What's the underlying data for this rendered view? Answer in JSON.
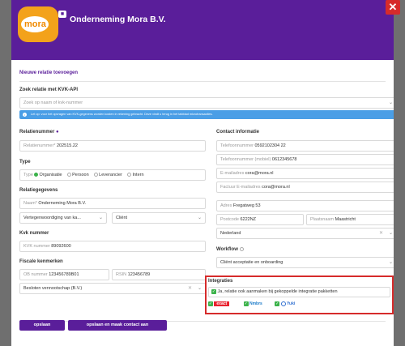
{
  "header": {
    "company_name": "Onderneming Mora B.V.",
    "logo_text": "mora"
  },
  "section_title": "Nieuwe relatie toevoegen",
  "kvk_api": {
    "label": "Zoek relatie met KVK-API",
    "placeholder": "Zoek op naam of kvk-nummer",
    "info": "Let op: voor het opvragen van KVK-gegevens worden kosten in rekening gebracht. Deze vindt u terug in het tabblad microtransacties."
  },
  "relatienummer": {
    "label": "Relatienummer",
    "prefix": "Relatienummer*",
    "value": "202515.22"
  },
  "type": {
    "label": "Type",
    "prefix": "Type",
    "options": [
      "Organisatie",
      "Persoon",
      "Leverancier",
      "Intern"
    ],
    "selected": "Organisatie"
  },
  "relatiegegevens": {
    "label": "Relatiegegevens",
    "name_prefix": "Naam*",
    "name_value": "Onderneming Mora B.V.",
    "proxy_placeholder": "Vertegenwoordiging van ka...",
    "client_type": "Cliënt"
  },
  "kvk": {
    "label": "Kvk nummer",
    "prefix": "KVK nummer",
    "value": "89092600"
  },
  "fiscale": {
    "label": "Fiscale kenmerken",
    "ob_prefix": "OB nummer",
    "ob_value": "123456789B01",
    "rsin_prefix": "RSIN",
    "rsin_value": "123456789",
    "legal_form": "Besloten vennootschap (B.V.)"
  },
  "contact": {
    "label": "Contact informatie",
    "phone_prefix": "Telefoonnummer",
    "phone_value": "0592102304 22",
    "mobile_prefix": "Telefoonnummer (mobiel)",
    "mobile_value": "0612345678",
    "email_prefix": "E-mailadres",
    "email_value": "cora@mora.nl",
    "invoice_email_prefix": "Factuur E-mailadres",
    "invoice_email_value": "cora@mora.nl"
  },
  "address": {
    "street_prefix": "Adres",
    "street_value": "Fregatweg 53",
    "postcode_prefix": "Postcode",
    "postcode_value": "6222NZ",
    "city_prefix": "Plaatsnaam",
    "city_value": "Maastricht",
    "country": "Nederland"
  },
  "workflow": {
    "label": "Workflow",
    "value": "Cliënt acceptatie en onboarding"
  },
  "integraties": {
    "label": "Integraties",
    "checkbox_label": "Ja, relatie ook aanmaken bij gekoppelde integratie pakketten",
    "logos": [
      "exact",
      "Nmbrs",
      "Yuki"
    ]
  },
  "buttons": {
    "save": "opslaan",
    "save_contact": "opslaan en maak contact aan"
  },
  "colors": {
    "brand_purple": "#5a1e9a",
    "highlight_red": "#d62b2b",
    "info_blue": "#4a9ee6",
    "check_green": "#3bb24a",
    "logo_orange": "#f3a21b"
  }
}
